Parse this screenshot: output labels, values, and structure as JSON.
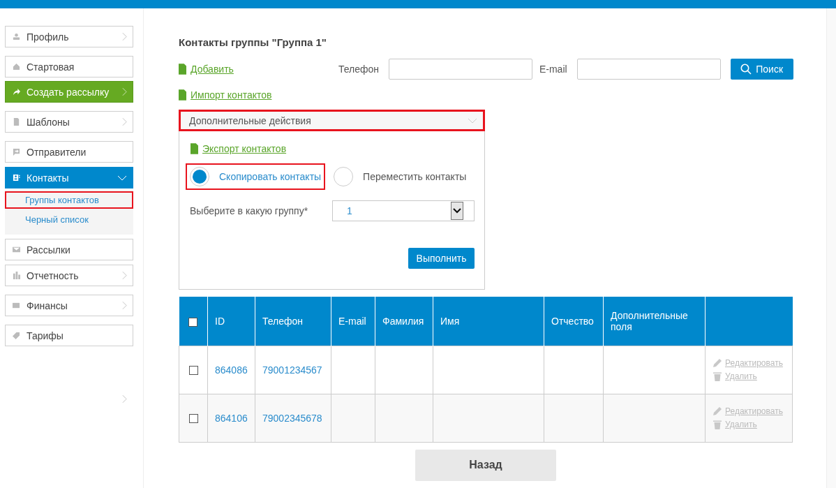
{
  "sidebar": {
    "items": [
      {
        "label": "Профиль",
        "kind": "default",
        "chevron": true
      },
      {
        "label": "Стартовая",
        "kind": "default",
        "chevron": false
      },
      {
        "label": "Создать рассылку",
        "kind": "action",
        "chevron": true
      },
      {
        "label": "Шаблоны",
        "kind": "default",
        "chevron": true
      },
      {
        "label": "Отправители",
        "kind": "default",
        "chevron": false
      },
      {
        "label": "Контакты",
        "kind": "active",
        "chevron": true,
        "children": [
          {
            "label": "Группы контактов",
            "highlighted": true
          },
          {
            "label": "Черный список",
            "highlighted": false
          }
        ]
      },
      {
        "label": "Рассылки",
        "kind": "default",
        "chevron": false
      },
      {
        "label": "Отчетность",
        "kind": "default",
        "chevron": true
      },
      {
        "label": "Финансы",
        "kind": "default",
        "chevron": true
      },
      {
        "label": "Тарифы",
        "kind": "default",
        "chevron": false
      }
    ]
  },
  "title": "Контакты группы \"Группа 1\"",
  "links": [
    "Добавить",
    "Импорт контактов"
  ],
  "search": {
    "phone_label": "Телефон",
    "email_label": "E-mail",
    "button": "Поиск"
  },
  "actions_panel": {
    "header": "Дополнительные действия",
    "highlighted": true,
    "expanded": true,
    "export_link": "Экспорт контактов",
    "radios": [
      {
        "label": "Скопировать контакты",
        "selected": true,
        "highlighted": true
      },
      {
        "label": "Переместить контакты",
        "selected": false,
        "highlighted": false
      }
    ],
    "group_label": "Выберите в какую группу*",
    "group_value": "1",
    "submit": "Выполнить"
  },
  "table": {
    "all_checked": false,
    "columns": [
      "ID",
      "Телефон",
      "E-mail",
      "Фамилия",
      "Имя",
      "Отчество",
      "Дополнительные поля"
    ],
    "rows": [
      {
        "checked": false,
        "id": "864086",
        "phone": "79001234567",
        "edit": "Редактировать",
        "delete": "Удалить"
      },
      {
        "checked": false,
        "id": "864106",
        "phone": "79002345678",
        "edit": "Редактировать",
        "delete": "Удалить"
      }
    ]
  },
  "back_button": "Назад"
}
